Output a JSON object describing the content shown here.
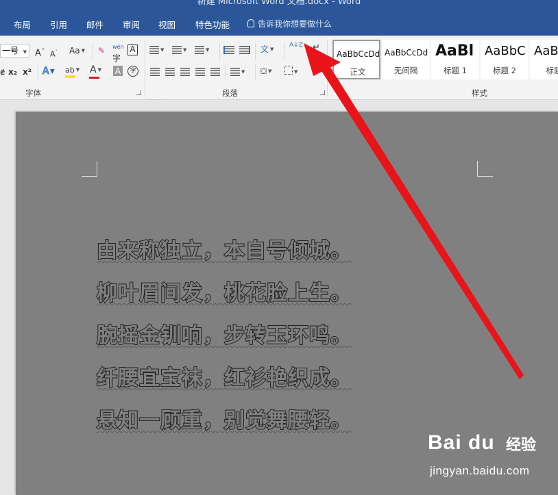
{
  "window": {
    "title": "新建 Microsoft Word 文档.docx  -  Word"
  },
  "tabs": [
    "布局",
    "引用",
    "邮件",
    "审阅",
    "视图",
    "特色功能"
  ],
  "tell_me": {
    "placeholder": "告诉我你想要做什么"
  },
  "font_group": {
    "label": "字体",
    "font_size_value": "一号",
    "grow_label": "A",
    "shrink_label": "A",
    "change_case_label": "Aa",
    "phonetic_label": "wén",
    "char_border_label": "A",
    "subscript_label": "x₂",
    "superscript_label": "x²",
    "text_effects_label": "A",
    "highlight_label": "ab",
    "font_color_label": "A",
    "char_shading_label": "A",
    "enclose_label": "字"
  },
  "paragraph_group": {
    "label": "段落",
    "sort_label": "A↓Z"
  },
  "styles_group": {
    "label": "样式",
    "items": [
      {
        "preview": "AaBbCcDd",
        "name": "正文"
      },
      {
        "preview": "AaBbCcDd",
        "name": "无间隔"
      },
      {
        "preview": "AaBl",
        "name": "标题 1"
      },
      {
        "preview": "AaBbC",
        "name": "标题 2"
      },
      {
        "preview": "AaB",
        "name": "标题"
      }
    ]
  },
  "document": {
    "lines": [
      "由来称独立，本自号倾城。",
      "柳叶眉间发，桃花脸上生。",
      "腕摇金钏响，步转玉环鸣。",
      "纤腰宜宝袜，红衫艳织成。",
      "悬知一顾重，别觉舞腰轻。"
    ]
  },
  "watermark": {
    "brand": "Bai du",
    "text": "经验",
    "url": "jingyan.baidu.com"
  },
  "colors": {
    "title_bar": "#2b579a",
    "page": "#808080",
    "arrow": "#e8141a",
    "font_color_bar": "#d12020",
    "highlight_bar": "#ffe600"
  }
}
